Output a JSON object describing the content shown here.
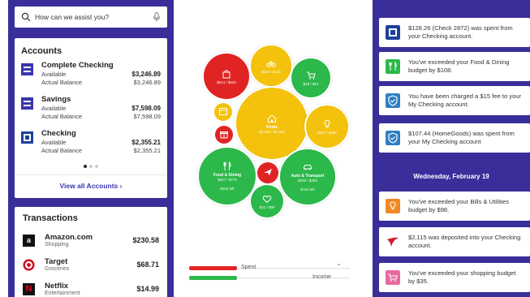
{
  "search": {
    "placeholder": "How can we assist you?"
  },
  "accounts": {
    "title": "Accounts",
    "items": [
      {
        "name": "Complete Checking",
        "available_label": "Available",
        "available": "$3,246.89",
        "actual_label": "Actual Balance",
        "actual": "$3,246.89",
        "icon": "bank-lines-icon"
      },
      {
        "name": "Savings",
        "available_label": "Available",
        "available": "$7,598.09",
        "actual_label": "Actual Balance",
        "actual": "$7,598.09",
        "icon": "bank-lines-icon"
      },
      {
        "name": "Checking",
        "available_label": "Available",
        "available": "$2,355.21",
        "actual_label": "Actual Balance",
        "actual": "$2,355.21",
        "icon": "chase-logo-icon"
      }
    ],
    "view_all": "View all Accounts"
  },
  "transactions": {
    "title": "Transactions",
    "items": [
      {
        "name": "Amazon.com",
        "category": "Shopping",
        "amount": "$230.58",
        "logo": "a"
      },
      {
        "name": "Target",
        "category": "Groceries",
        "amount": "$68.71",
        "logo": "target"
      },
      {
        "name": "Netflix",
        "category": "Entertainment",
        "amount": "$14.99",
        "logo": "N"
      }
    ]
  },
  "budget_bubbles": {
    "home": {
      "name": "Home",
      "value": "$1,140 / $1,300"
    },
    "food": {
      "name": "Food & Dining",
      "value": "$507 / $775"
    },
    "auto": {
      "name": "Auto & Transport",
      "value": "$249 / $450"
    },
    "left_red": {
      "value": "$614 / $520"
    },
    "top_yellow": {
      "value": "$110 / $120"
    },
    "right_green": {
      "value": "$18 / $23"
    },
    "util": {
      "value": "$220 / $285"
    },
    "small_green": {
      "value": "$31 / $99"
    },
    "food_sub": "$253 left",
    "auto_sub": "$152 left",
    "colors": {
      "over": "#e02424",
      "near": "#f4c20d",
      "under": "#2cb84a"
    }
  },
  "legend": {
    "spent": "Spent",
    "income": "Income",
    "spent_fill": 0.3,
    "income_fill": 0.3
  },
  "notifications": [
    {
      "text": "$128.26 (Check 2872) was spent from your Checking account.",
      "icon": "chase-logo-icon",
      "color": "#1f3f9c"
    },
    {
      "text": "You've exceeded your Food & Dining budget by $108.",
      "icon": "fork-knife-icon",
      "color": "#2cb84a"
    },
    {
      "text": "You have been charged a $15 fee to your My Checking account.",
      "icon": "shield-check-icon",
      "color": "#2e7fc4"
    },
    {
      "text": "$107.44 (HomeGoods) was spent from your My Checking account",
      "icon": "shield-check-icon",
      "color": "#2e7fc4"
    }
  ],
  "date_header": "Wednesday, February 19",
  "notifications_2": [
    {
      "text": "You've exceeded your Bills & Utilities budget by $98.",
      "icon": "bulb-icon",
      "color": "#f08a24"
    },
    {
      "text": "$2,115 was deposited into your Checking account.",
      "icon": "swoosh-logo-icon",
      "color": "#d01f2e"
    },
    {
      "text": "You've exceeded your shopping budget by $35.",
      "icon": "cart-icon",
      "color": "#e96aa0"
    }
  ]
}
